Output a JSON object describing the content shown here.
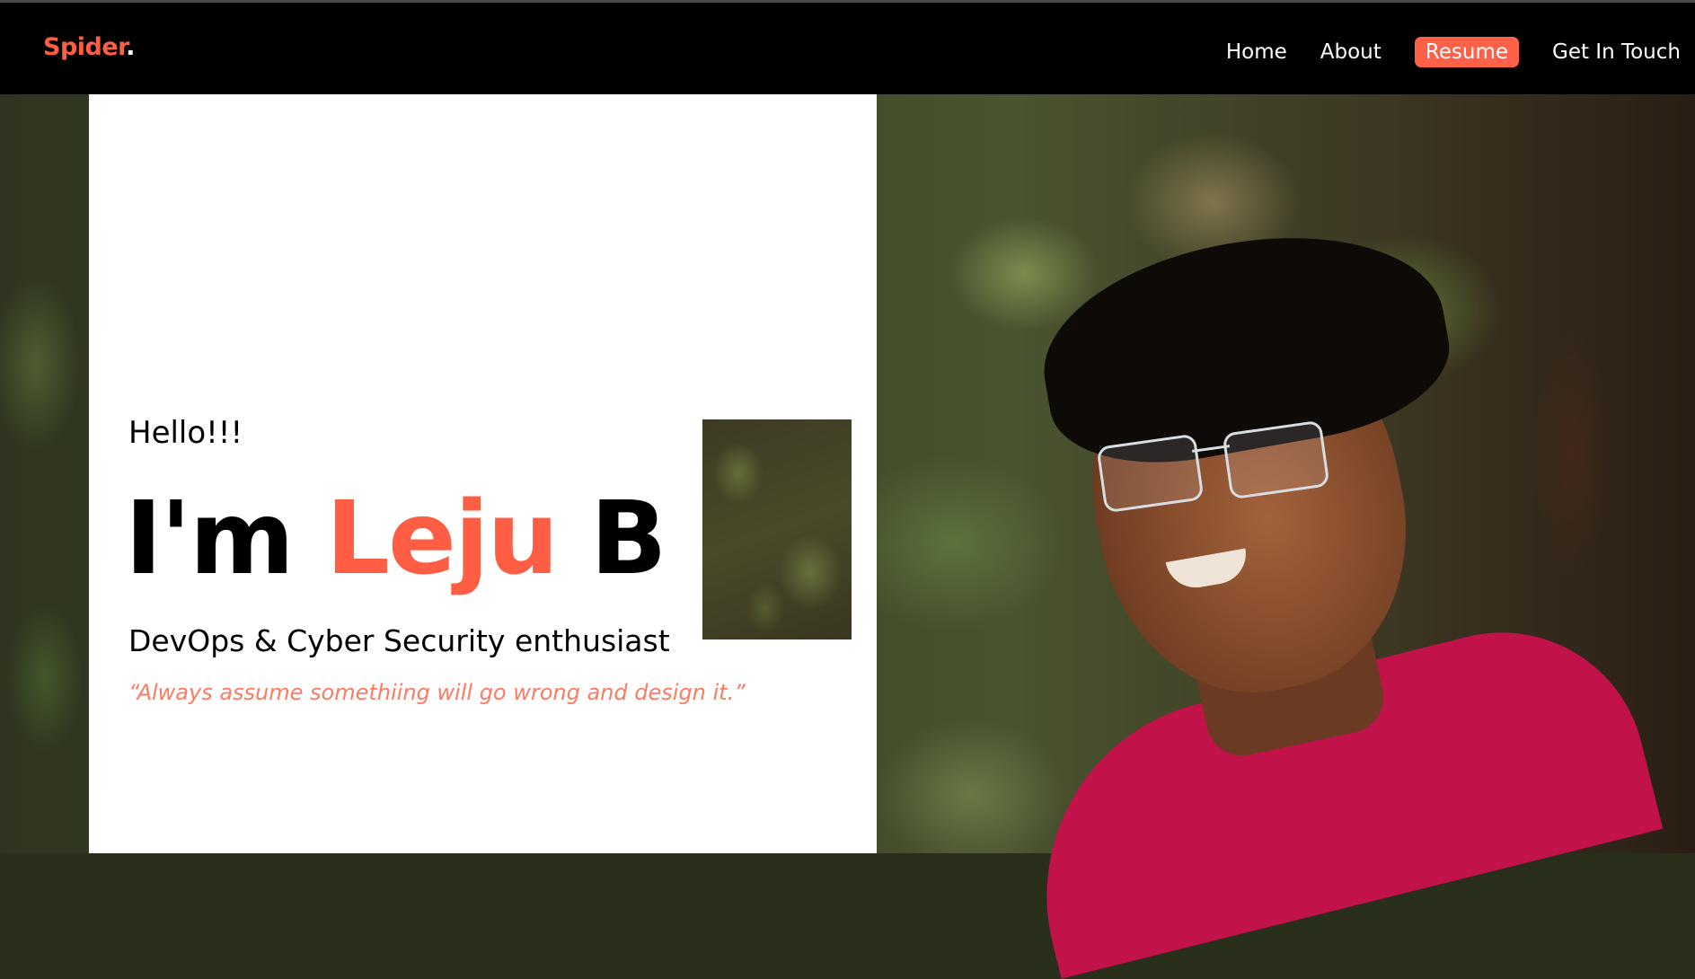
{
  "nav": {
    "logo_text": "Spider",
    "logo_dot": ".",
    "links": [
      {
        "label": "Home"
      },
      {
        "label": "About"
      },
      {
        "label": "Resume",
        "active": true
      },
      {
        "label": "Get In Touch"
      }
    ]
  },
  "hero": {
    "greeting": "Hello!!!",
    "headline_prefix": "I'm ",
    "headline_name": "Leju",
    "headline_suffix": " B",
    "role": "DevOps & Cyber Security enthusiast",
    "quote": "“Always assume somethiing will go wrong and design it.”"
  },
  "colors": {
    "accent": "#ff5e45",
    "navbar": "#000000",
    "panel": "#ffffff"
  }
}
